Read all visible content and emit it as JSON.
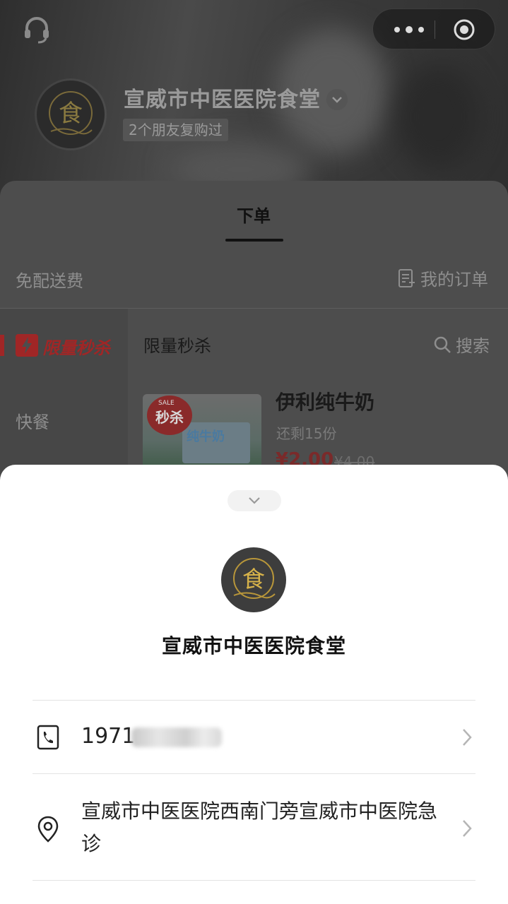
{
  "header": {
    "store_name": "宣威市中医医院食堂",
    "friends_tag": "2个朋友复购过",
    "logo_glyph": "食"
  },
  "tabs": {
    "order_label": "下单"
  },
  "info_bar": {
    "free_delivery": "免配送费",
    "my_orders": "我的订单"
  },
  "sidebar": {
    "items": [
      {
        "label": "限量秒杀",
        "active": true
      },
      {
        "label": "快餐",
        "active": false
      }
    ]
  },
  "section": {
    "title": "限量秒杀",
    "search_label": "搜索"
  },
  "product": {
    "name": "伊利纯牛奶",
    "stock": "还剩15份",
    "price": "¥2.00",
    "original_price": "¥4.00",
    "badge": "秒杀",
    "badge_small": "SALE",
    "package_text": "纯牛奶"
  },
  "sheet": {
    "store_name": "宣威市中医医院食堂",
    "logo_glyph": "食",
    "phone_visible": "1971",
    "address": "宣威市中医医院西南门旁宣威市中医院急诊"
  },
  "colors": {
    "accent_red": "#e02b2b",
    "sheet_bg": "#ffffff",
    "overlay": "#4d4d4d"
  }
}
